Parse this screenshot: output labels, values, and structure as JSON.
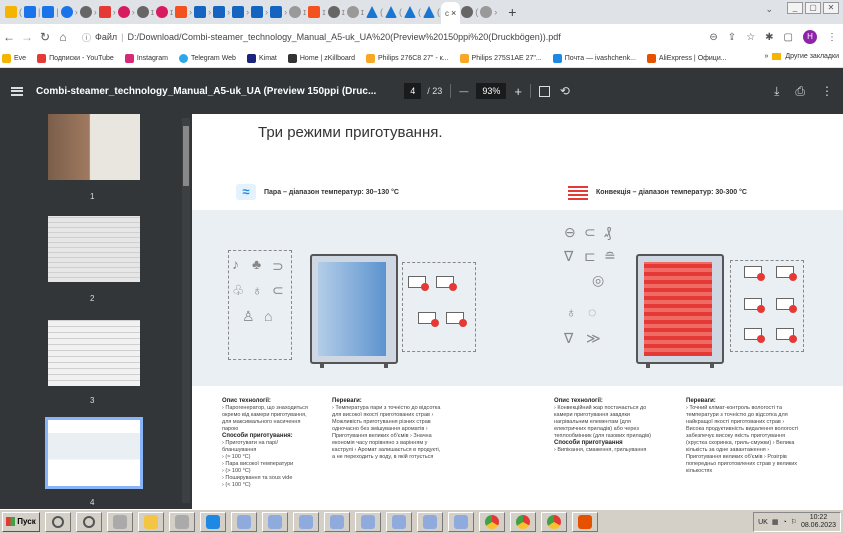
{
  "browser": {
    "active_tab_close": "×",
    "new_tab": "+",
    "tab_dropdown": "⌄",
    "window_controls": [
      "_",
      "▢",
      "✕"
    ],
    "file_label": "Файл",
    "url": "D:/Download/Combi-steamer_technology_Manual_A5-uk_UA%20(Preview%20150ppi%20(Druckbögen)).pdf",
    "profile_initial": "Н"
  },
  "bookmarks": [
    {
      "label": "Eve",
      "color": "#f4b400"
    },
    {
      "label": "Подписки - YouTube",
      "color": "#e53935"
    },
    {
      "label": "Instagram",
      "color": "#d62976"
    },
    {
      "label": "Telegram Web",
      "color": "#29a9eb"
    },
    {
      "label": "Kimat",
      "color": "#1a237e"
    },
    {
      "label": "Home | zKillboard",
      "color": "#333"
    },
    {
      "label": "Philips 276C8 27\" - к...",
      "color": "#f9a825"
    },
    {
      "label": "Philips 275S1AE 27\"...",
      "color": "#f9a825"
    },
    {
      "label": "Почта — ivashchenk...",
      "color": "#1e88e5"
    },
    {
      "label": "AliExpress | Офици...",
      "color": "#e65100"
    }
  ],
  "bookmarks_more": "»",
  "bookmarks_other": "Другие закладки",
  "pdf": {
    "title": "Combi-steamer_technology_Manual_A5-uk_UA (Preview 150ppi (Druc...",
    "page_current": "4",
    "page_total": "/ 23",
    "zoom_minus": "—",
    "zoom": "93%",
    "zoom_plus": "+"
  },
  "thumbnails": [
    "1",
    "2",
    "3",
    "4"
  ],
  "content": {
    "title": "Три режими приготування.",
    "steam_header": "Пара – діапазон температур: 30–130 °C",
    "conv_header": "Конвекція – діапазон температур: 30-300 °C",
    "steam_tech_title": "Опис технології:",
    "steam_tech": "› Парогенератор, що знаходиться окремо від камери приготування, для максимального насичення парою",
    "steam_methods_title": "Способи приготування:",
    "steam_methods": [
      "› Приготувати на парі/бланшування",
      "› (≈ 100 °C)",
      "› Пара високої температури",
      "› (> 100 °C)",
      "› Поширування та sous vide",
      "› (< 100 °C)"
    ],
    "steam_adv_title": "Переваги:",
    "steam_adv": "› Температура пари з точністю до відсотка для високої якості приготованих страв › Можливість приготування різних страв одночасно без змішування ароматів › Приготування великих об'ємів › Значна економія часу порівняно з варінням у каструлі › Аромат залишається в продукті, а не переходить у воду, в якій готується",
    "conv_tech_title": "Опис технології:",
    "conv_tech": "› Конвекційний жар постачається до камери приготування завдяки нагрівальним елементам (для електричних приладів) або через теплообмінник (для газових приладів)",
    "conv_methods_title": "Способи приготування",
    "conv_methods": "› Випікання, смаження, гриль­ування",
    "conv_adv_title": "Переваги:",
    "conv_adv": "› Точний клімат-контроль вологості та температури з точністю до відсотка для найкращої якості приготованих страв › Висока продуктивність видалення вологості забезпечує високу якість приготування (хрустка скоринка, гриль-смужки) › Велика кількість за одне завантаження › Приготування великих об'ємів › Розігрів попередньо приготовлених страв у великих кількостях"
  },
  "taskbar": {
    "start": "Пуск",
    "lang": "UK",
    "time": "10:22",
    "date": "08.06.2023"
  }
}
